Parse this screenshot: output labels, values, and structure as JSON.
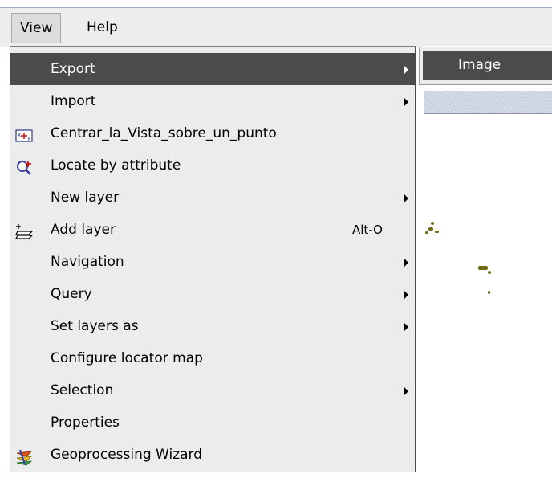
{
  "menubar": {
    "items": [
      {
        "label": "View"
      },
      {
        "label": "Help"
      }
    ]
  },
  "view_menu": {
    "items": [
      {
        "label": "Export",
        "has_submenu": true,
        "selected": true
      },
      {
        "label": "Import",
        "has_submenu": true
      },
      {
        "label": "Centrar_la_Vista_sobre_un_punto",
        "icon": "center-view-icon"
      },
      {
        "label": "Locate by attribute",
        "icon": "locate-attribute-icon"
      },
      {
        "label": "New layer",
        "has_submenu": true
      },
      {
        "label": "Add layer",
        "icon": "add-layer-icon",
        "accelerator": "Alt-O"
      },
      {
        "label": "Navigation",
        "has_submenu": true
      },
      {
        "label": "Query",
        "has_submenu": true
      },
      {
        "label": "Set layers as",
        "has_submenu": true
      },
      {
        "label": "Configure locator map"
      },
      {
        "label": "Selection",
        "has_submenu": true
      },
      {
        "label": "Properties"
      },
      {
        "label": "Geoprocessing Wizard",
        "icon": "geoprocessing-wizard-icon"
      }
    ]
  },
  "export_submenu": {
    "items": [
      {
        "label": "Image"
      }
    ]
  }
}
